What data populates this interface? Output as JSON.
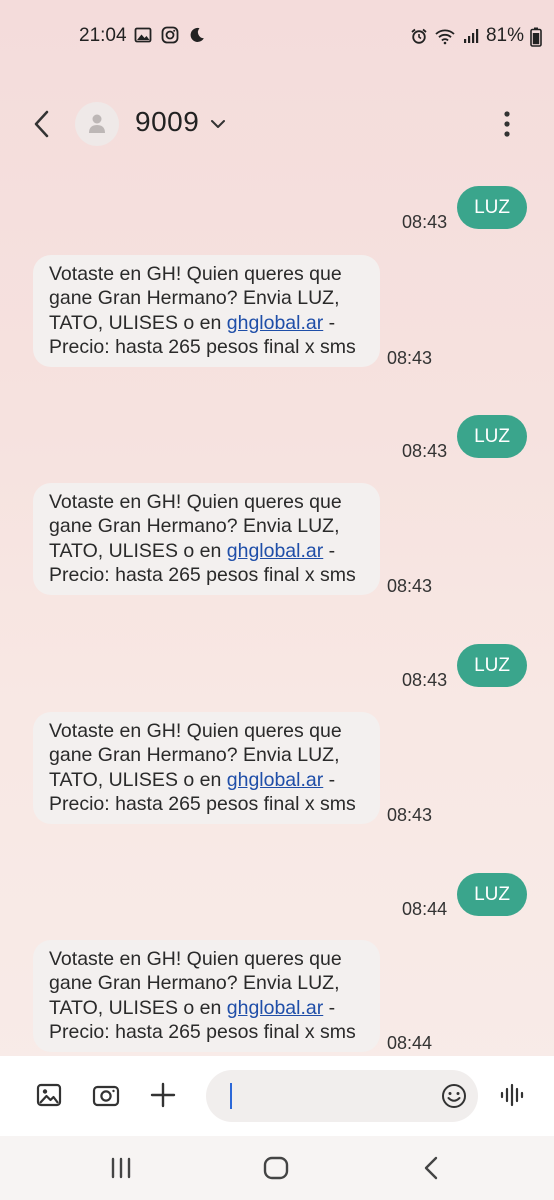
{
  "status_bar": {
    "time": "21:04",
    "battery": "81%"
  },
  "header": {
    "contact_name": "9009"
  },
  "messages": [
    {
      "direction": "out",
      "text": "LUZ",
      "time": "08:43"
    },
    {
      "direction": "in",
      "text_before": "Votaste en GH! Quien queres que gane Gran Hermano? Envia LUZ, TATO, ULISES o en ",
      "link": "ghglobal.ar",
      "text_after": " - Precio: hasta 265 pesos final x sms",
      "time": "08:43"
    },
    {
      "direction": "out",
      "text": "LUZ",
      "time": "08:43"
    },
    {
      "direction": "in",
      "text_before": "Votaste en GH! Quien queres que gane Gran Hermano? Envia LUZ, TATO, ULISES o en ",
      "link": "ghglobal.ar",
      "text_after": " - Precio: hasta 265 pesos final x sms",
      "time": "08:43"
    },
    {
      "direction": "out",
      "text": "LUZ",
      "time": "08:43"
    },
    {
      "direction": "in",
      "text_before": "Votaste en GH! Quien queres que gane Gran Hermano? Envia LUZ, TATO, ULISES o en ",
      "link": "ghglobal.ar",
      "text_after": " - Precio: hasta 265 pesos final x sms",
      "time": "08:43"
    },
    {
      "direction": "out",
      "text": "LUZ",
      "time": "08:44"
    },
    {
      "direction": "in",
      "text_before": "Votaste en GH! Quien queres que gane Gran Hermano? Envia LUZ, TATO, ULISES o en ",
      "link": "ghglobal.ar",
      "text_after": " - Precio: hasta 265 pesos final x sms",
      "time": "08:44"
    }
  ],
  "compose": {
    "value": ""
  },
  "colors": {
    "outgoing_bubble": "#3aa58c",
    "incoming_bubble": "#f3f0ef",
    "link": "#1f4ea8",
    "cursor": "#2c68d8"
  },
  "icons": {
    "status_left": [
      "gallery-icon",
      "instagram-icon",
      "moon-icon"
    ],
    "status_right": [
      "alarm-icon",
      "wifi-icon",
      "signal-icon",
      "battery-icon"
    ],
    "compose": [
      "gallery-icon",
      "camera-icon",
      "plus-icon",
      "emoji-icon",
      "voice-icon"
    ],
    "nav": [
      "recents-icon",
      "home-icon",
      "back-icon"
    ]
  }
}
